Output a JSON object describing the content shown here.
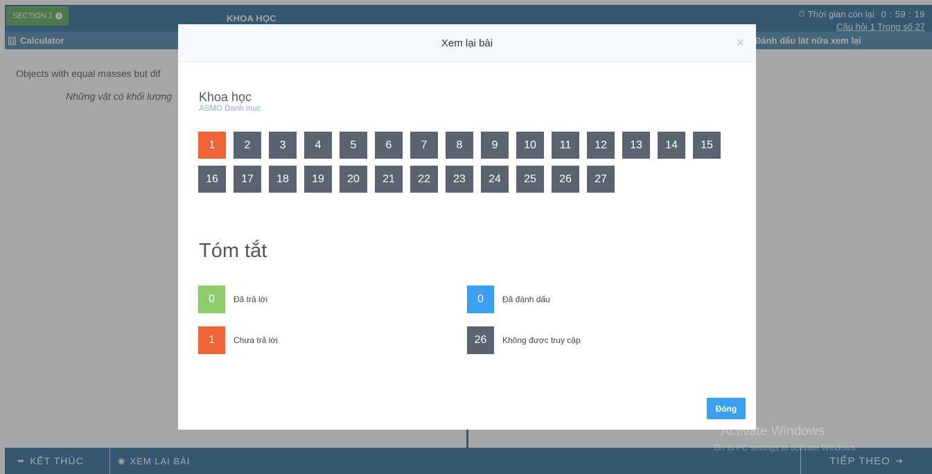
{
  "app": {
    "section_label": "SECTION 1",
    "title": "KHOA HỌC",
    "timer_label": "Thời gian còn lại",
    "timer_value": "0 : 59 : 19",
    "question_counter": "Câu hỏi 1 Trong số 27",
    "calculator_label": "Calculator",
    "mark_later_label": "Đánh dấu lát nữa xem lại",
    "question_text": "Objects with equal masses but dif",
    "question_translation": "Những vật có khối lượng",
    "watermark_title": "Activate Windows",
    "watermark_sub": "Go to PC settings to activate Windows.",
    "end_label": "KẾT THÚC",
    "review_label": "XEM LẠI BÀI",
    "next_label": "TIẾP THEO"
  },
  "modal": {
    "title": "Xem lại bài",
    "close_glyph": "×",
    "subject": "Khoa học",
    "subject_sub": "ASMO Danh mục",
    "current_question": 1,
    "questions": [
      "1",
      "2",
      "3",
      "4",
      "5",
      "6",
      "7",
      "8",
      "9",
      "10",
      "11",
      "12",
      "13",
      "14",
      "15",
      "16",
      "17",
      "18",
      "19",
      "20",
      "21",
      "22",
      "23",
      "24",
      "25",
      "26",
      "27"
    ],
    "summary_title": "Tóm tắt",
    "summary": {
      "answered": {
        "count": "0",
        "label": "Đã trả lời",
        "color": "#8ccd6a"
      },
      "flagged": {
        "count": "0",
        "label": "Đã đánh dấu",
        "color": "#3b9ff0"
      },
      "unanswered": {
        "count": "1",
        "label": "Chưa trả lời",
        "color": "#f0643a"
      },
      "not_visited": {
        "count": "26",
        "label": "Không được truy cập",
        "color": "#5c6370"
      }
    },
    "close_button": "Đóng"
  }
}
